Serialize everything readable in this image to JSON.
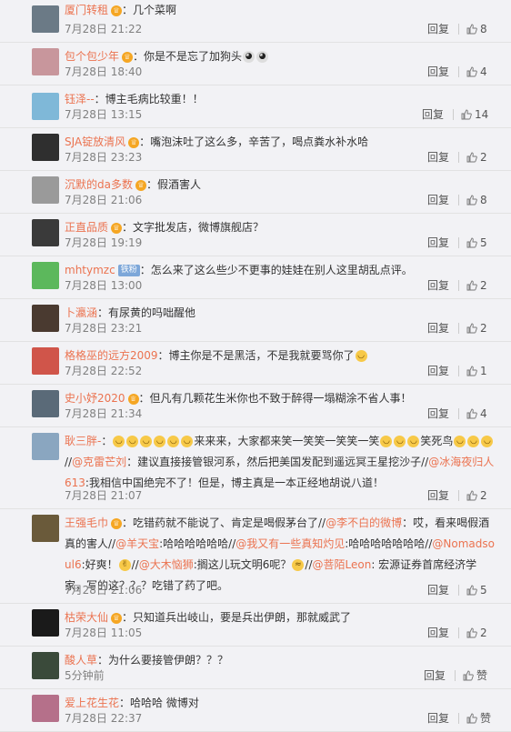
{
  "reply_label": "回复",
  "accent": "#eb7350",
  "rows": [
    {
      "user": "厦门转租",
      "badge": "vip",
      "segments": [
        {
          "t": "：几个菜啊"
        }
      ],
      "date": "7月28日 21:22",
      "likes": "8",
      "avatar_color": "#6b7a86",
      "short": true
    },
    {
      "user": "包个包少年",
      "badge": "vip",
      "segments": [
        {
          "t": "：你是不是忘了加狗头"
        },
        {
          "emo": "panda"
        },
        {
          "emo": "panda"
        }
      ],
      "date": "7月28日 18:40",
      "likes": "4",
      "avatar_color": "#c8969c",
      "short": false
    },
    {
      "user": "钰泽--",
      "badge": "",
      "segments": [
        {
          "t": "：博主毛病比较重！！"
        }
      ],
      "date": "7月28日 13:15",
      "likes": "14",
      "avatar_color": "#7fb8d8",
      "short": false
    },
    {
      "user": "SJA锭放清风",
      "badge": "vip",
      "segments": [
        {
          "t": "：嘴泡沫吐了这么多，辛苦了，喝点粪水补水哈"
        }
      ],
      "date": "7月28日 23:23",
      "likes": "2",
      "avatar_color": "#2f2f2f",
      "short": false
    },
    {
      "user": "沉默的da多数",
      "badge": "vip",
      "segments": [
        {
          "t": "：假酒害人"
        }
      ],
      "date": "7月28日 21:06",
      "likes": "8",
      "avatar_color": "#9a9a9a",
      "short": false
    },
    {
      "user": "正直品质",
      "badge": "vip",
      "segments": [
        {
          "t": "：文字批发店，微博旗舰店？"
        }
      ],
      "date": "7月28日 19:19",
      "likes": "5",
      "avatar_color": "#3a3a3a",
      "short": false
    },
    {
      "user": "mhtymzc",
      "badge": "tie",
      "segments": [
        {
          "t": "：怎么来了这么些少不更事的娃娃在别人这里胡乱点评。"
        }
      ],
      "date": "7月28日 13:00",
      "likes": "2",
      "avatar_color": "#5cb85c",
      "short": false
    },
    {
      "user": "卜瀛涵",
      "badge": "",
      "segments": [
        {
          "t": "：有尿黄的吗咄醒他"
        }
      ],
      "date": "7月28日 23:21",
      "likes": "2",
      "avatar_color": "#4a3a30",
      "short": false
    },
    {
      "user": "格格巫的远方2009",
      "badge": "",
      "segments": [
        {
          "t": "：博主你是不是黑活，不是我就要骂你了"
        },
        {
          "emo": "smile"
        }
      ],
      "date": "7月28日 22:52",
      "likes": "1",
      "avatar_color": "#d0554a",
      "short": false
    },
    {
      "user": "史小妤2020",
      "badge": "vip",
      "segments": [
        {
          "t": "：但凡有几颗花生米你也不致于醉得一塌糊涂不省人事！"
        }
      ],
      "date": "7月28日 21:34",
      "likes": "4",
      "avatar_color": "#5a6a78",
      "short": false
    },
    {
      "user": "耿三胖-",
      "badge": "",
      "segments": [
        {
          "t": "："
        },
        {
          "emo": "laugh"
        },
        {
          "emo": "laugh"
        },
        {
          "emo": "laugh"
        },
        {
          "emo": "laugh"
        },
        {
          "emo": "laugh"
        },
        {
          "emo": "laugh"
        },
        {
          "t": "来来来，大家都来笑一笑笑一笑笑一笑"
        },
        {
          "emo": "laugh"
        },
        {
          "emo": "laugh"
        },
        {
          "emo": "laugh"
        },
        {
          "t": "笑死鸟"
        },
        {
          "emo": "laugh"
        },
        {
          "emo": "laugh"
        },
        {
          "emo": "laugh"
        },
        {
          "t": "//"
        },
        {
          "m": "@克雷芒刘"
        },
        {
          "t": "：建议直接接管银河系，然后把美国发配到遥远冥王星挖沙子//"
        },
        {
          "m": "@冰海夜归人613"
        },
        {
          "t": ":我相信中国绝完不了！但是，博主真是一本正经地胡说八道！"
        }
      ],
      "date": "7月28日 21:07",
      "likes": "2",
      "avatar_color": "#8aa6c0",
      "short": false
    },
    {
      "user": "王强毛巾",
      "badge": "vip",
      "segments": [
        {
          "t": "：吃错药就不能说了、肯定是喝假茅台了//"
        },
        {
          "m": "@李不白的微博"
        },
        {
          "t": "：哎，看来喝假酒真的害人//"
        },
        {
          "m": "@羊天宝"
        },
        {
          "t": ":哈哈哈哈哈哈//"
        },
        {
          "m": "@我又有一些真知灼见"
        },
        {
          "t": ":哈哈哈哈哈哈哈//"
        },
        {
          "m": "@Nomadsoul6"
        },
        {
          "t": ":好爽！"
        },
        {
          "emo": "v"
        },
        {
          "t": "//"
        },
        {
          "m": "@大木恼狮"
        },
        {
          "t": ":搁这儿玩文明6呢？"
        },
        {
          "emo": "sweat"
        },
        {
          "t": "//"
        },
        {
          "m": "@菩陌Leon"
        },
        {
          "t": ": 宏源证券首席经济学家，写的这？？？吃错了药了吧。"
        }
      ],
      "date": "7月28日 21:06",
      "likes": "5",
      "avatar_color": "#6a5a3a",
      "short": false
    },
    {
      "user": "枯荣大仙",
      "badge": "vip",
      "segments": [
        {
          "t": "：只知道兵出岐山，要是兵出伊朗，那就威武了"
        }
      ],
      "date": "7月28日 11:05",
      "likes": "2",
      "avatar_color": "#1a1a1a",
      "short": false
    },
    {
      "user": "酸人草",
      "badge": "",
      "segments": [
        {
          "t": "：为什么要接管伊朗？？？"
        }
      ],
      "date": "5分钟前",
      "likes": "赞",
      "avatar_color": "#3a4a3a",
      "short": false
    },
    {
      "user": "爱上花生花",
      "badge": "",
      "segments": [
        {
          "t": "：哈哈哈  微博对"
        }
      ],
      "date": "7月28日 22:37",
      "likes": "赞",
      "avatar_color": "#b5708a",
      "short": false
    }
  ]
}
